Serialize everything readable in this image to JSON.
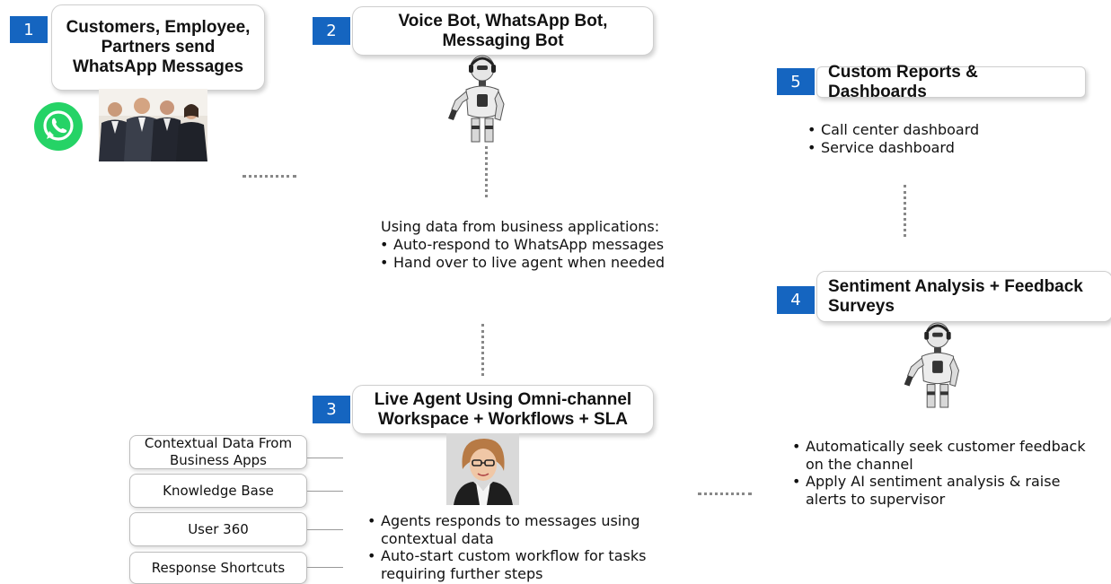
{
  "steps": [
    {
      "number": "1",
      "title": "Customers, Employee, Partners send WhatsApp Messages"
    },
    {
      "number": "2",
      "title": "Voice Bot, WhatsApp Bot, Messaging Bot"
    },
    {
      "number": "3",
      "title": "Live Agent Using Omni-channel Workspace + Workflows + SLA"
    },
    {
      "number": "4",
      "title": "Sentiment Analysis + Feedback Surveys"
    },
    {
      "number": "5",
      "title": "Custom Reports & Dashboards"
    }
  ],
  "bot_section": {
    "intro": "Using data from business applications:",
    "bullets": [
      "Auto-respond to WhatsApp messages",
      "Hand over to live agent when needed"
    ]
  },
  "agent_section": {
    "bullets": [
      "Agents responds to messages using contextual data",
      "Auto-start custom workflow for tasks requiring further steps"
    ],
    "side_items": [
      "Contextual Data From Business Apps",
      "Knowledge Base",
      "User 360",
      "Response Shortcuts"
    ]
  },
  "sentiment_section": {
    "bullets": [
      "Automatically seek customer feedback on the channel",
      "Apply AI sentiment analysis & raise alerts to supervisor"
    ]
  },
  "reports_section": {
    "bullets": [
      "Call center dashboard",
      "Service dashboard"
    ]
  },
  "colors": {
    "badge": "#1565c0",
    "whatsapp": "#25d366"
  }
}
